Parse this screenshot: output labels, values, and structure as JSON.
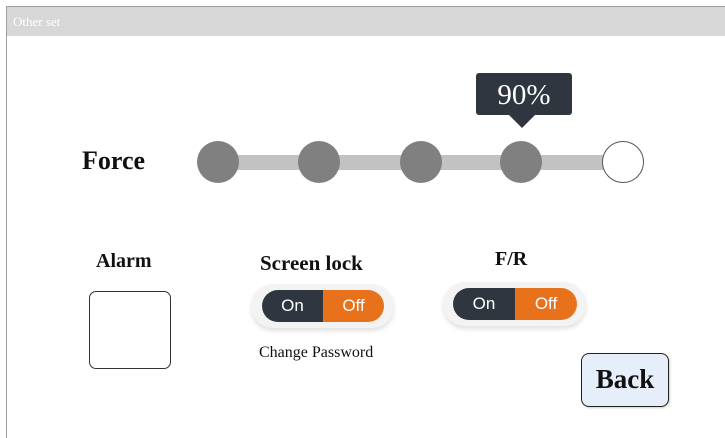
{
  "window": {
    "title": "Other set"
  },
  "force": {
    "label": "Force",
    "value_text": "90%",
    "level": 0.9,
    "step_count": 5,
    "selected_step": 4
  },
  "alarm": {
    "label": "Alarm"
  },
  "screen_lock": {
    "label": "Screen lock",
    "on_label": "On",
    "off_label": "Off",
    "state": "off",
    "change_password_label": "Change Password"
  },
  "fr": {
    "label": "F/R",
    "on_label": "On",
    "off_label": "Off",
    "state": "off"
  },
  "back_button": {
    "label": "Back"
  },
  "colors": {
    "title_bar": "#d7d7d7",
    "slider_knob": "#808080",
    "slider_track": "#c2c2c2",
    "tooltip": "#2f3640",
    "toggle_on": "#2f3640",
    "toggle_off": "#e8711c",
    "back_button_bg": "#e6eefa"
  }
}
